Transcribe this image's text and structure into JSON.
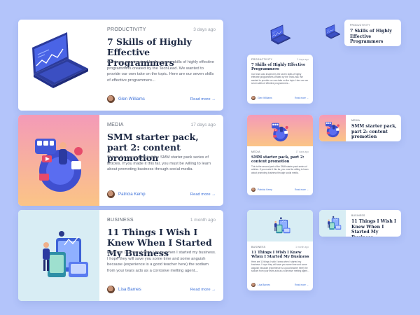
{
  "articles": [
    {
      "category": "PRODUCTIVITY",
      "time": "3 days ago",
      "title": "7 Skills of Highly Effective Programmers",
      "excerpt": "Our team was inspired by the seven skills of highly effective programmers created by the TechLead. We wanted to provide our own take on the topic. Here are our seven skills of effective programmers...",
      "author": "Glen Williams",
      "read_more": "Read more →",
      "illustration": "laptop-icon"
    },
    {
      "category": "MEDIA",
      "time": "17 days ago",
      "title": "SMM starter pack, part 2: content promotion",
      "excerpt": "This is the second part of the SMM starter pack series of articles. If you made it this far, you must be willing to learn about promoting business through social media.",
      "author": "Patricia Kemp",
      "read_more": "Read more →",
      "illustration": "social-media-icon"
    },
    {
      "category": "BUSINESS",
      "time": "1 month ago",
      "title": "11 Things I Wish I Knew When I Started My Business",
      "excerpt": "Here are 11 things I wish I knew when I started my business. I hope they will save you some time and some anguish because (experience is a good teacher here) the sodium from your tears acts as a corrosive melting agent...",
      "author": "Lisa Barnes",
      "read_more": "Read more →",
      "illustration": "business-icon"
    }
  ],
  "colors": {
    "background": "#b3c4fa",
    "card": "#ffffff",
    "title": "#1b2742",
    "link": "#3a6fd8",
    "media_gradient": [
      "#f49ab8",
      "#fbc486"
    ],
    "business_tint": "#d8edf4"
  }
}
